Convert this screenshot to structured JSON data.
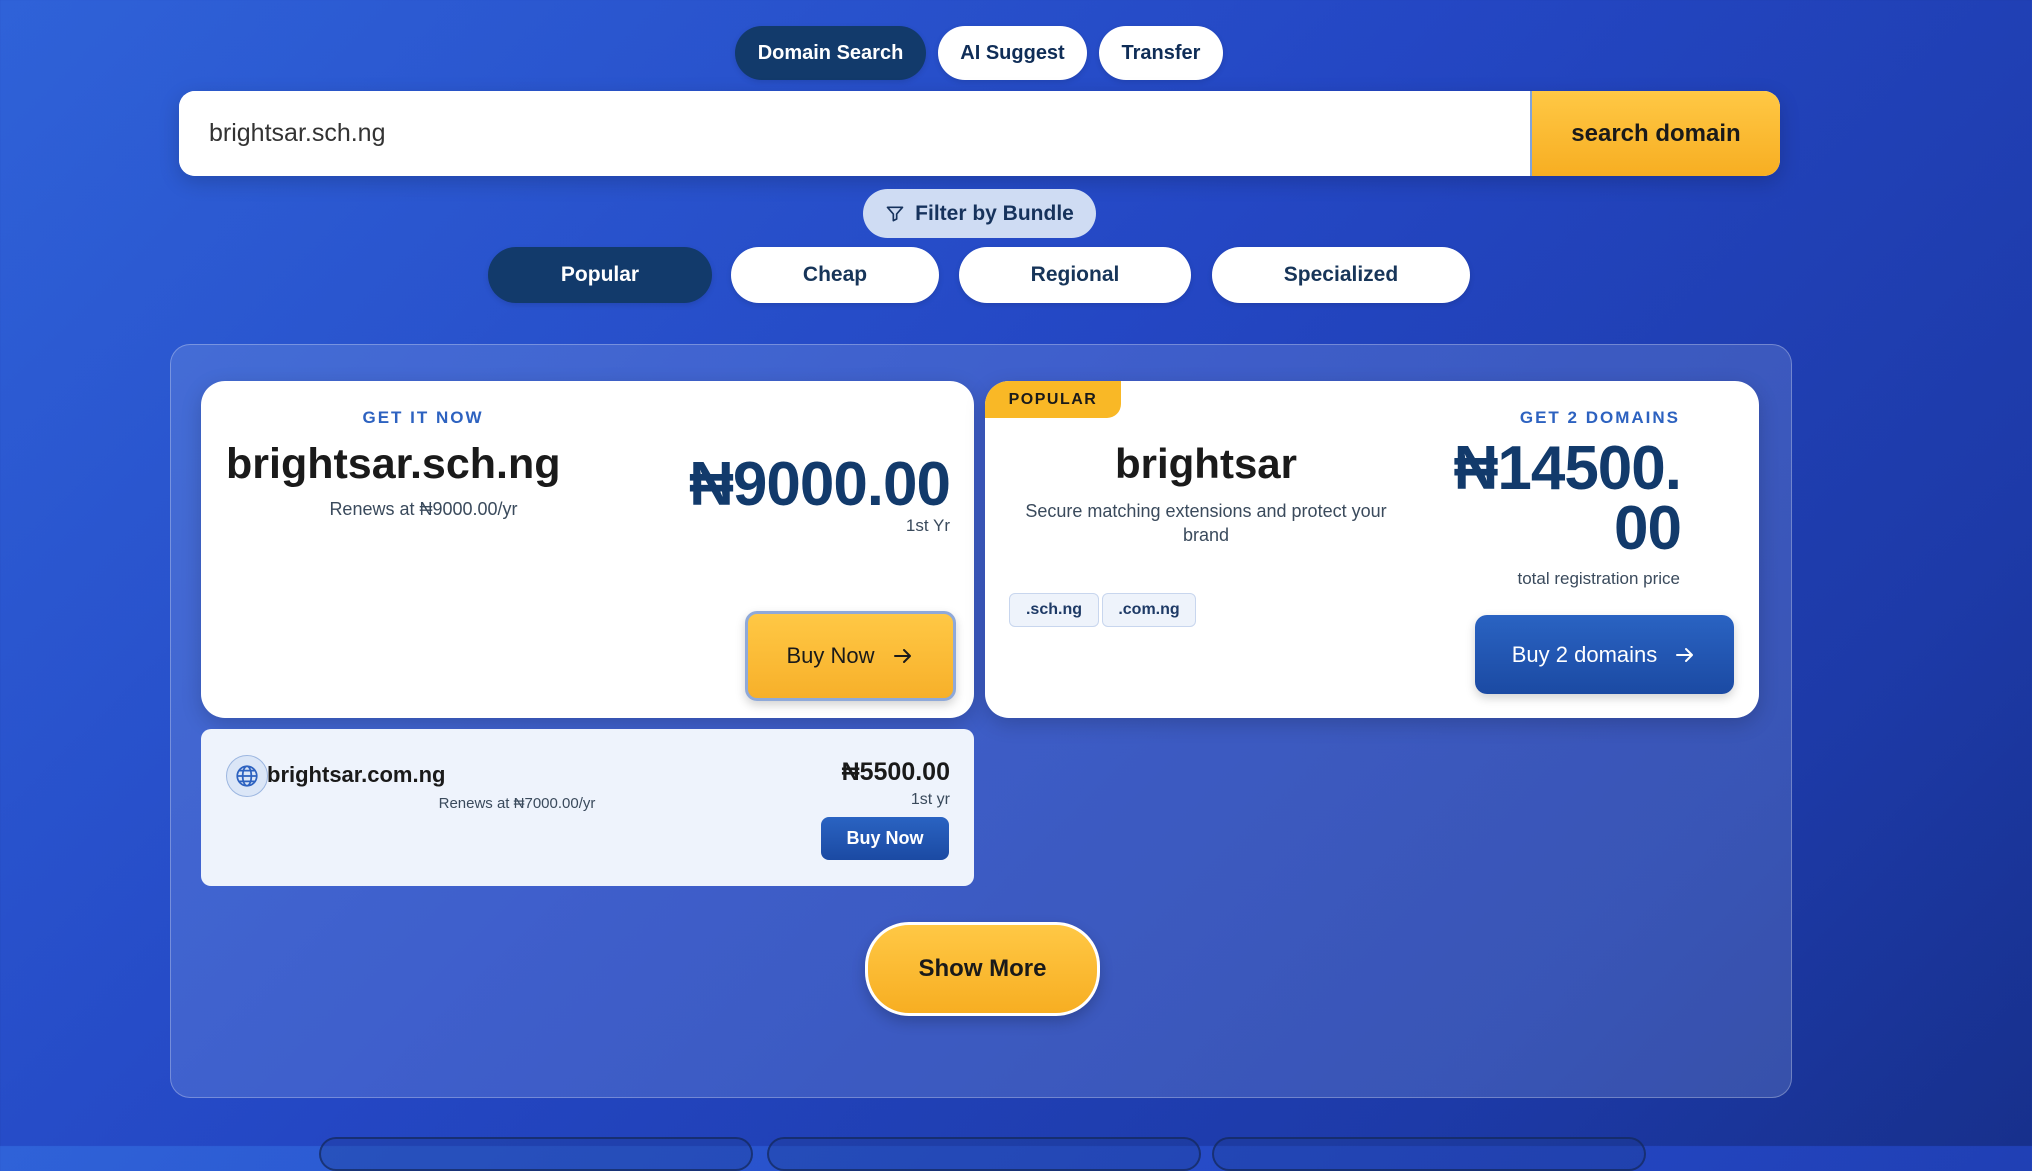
{
  "mode_tabs": [
    {
      "label": "Domain Search",
      "active": true
    },
    {
      "label": "AI Suggest",
      "active": false
    },
    {
      "label": "Transfer",
      "active": false
    }
  ],
  "search": {
    "value": "brightsar.sch.ng",
    "button_label": "search domain"
  },
  "filter": {
    "label": "Filter by Bundle",
    "icon": "filter-icon"
  },
  "categories": [
    {
      "label": "Popular",
      "active": true
    },
    {
      "label": "Cheap",
      "active": false
    },
    {
      "label": "Regional",
      "active": false
    },
    {
      "label": "Specialized",
      "active": false
    }
  ],
  "primary_card": {
    "eyebrow": "GET IT NOW",
    "domain": "brightsar.sch.ng",
    "renew_text": "Renews at ₦9000.00/yr",
    "price": "₦9000.00",
    "price_period": "1st Yr",
    "buy_label": "Buy Now"
  },
  "bundle_card": {
    "badge": "POPULAR",
    "eyebrow": "GET 2 DOMAINS",
    "name": "brightsar",
    "description": "Secure matching extensions and protect your brand",
    "price_line1": "₦14500.",
    "price_line2": "00",
    "price_caption": "total registration price",
    "extensions": [
      ".sch.ng",
      ".com.ng"
    ],
    "buy_label": "Buy 2 domains"
  },
  "alt_result": {
    "icon": "globe-icon",
    "domain": "brightsar.com.ng",
    "renew_text": "Renews at ₦7000.00/yr",
    "price": "₦5500.00",
    "price_period": "1st yr",
    "buy_label": "Buy Now"
  },
  "show_more_label": "Show More",
  "colors": {
    "navy": "#123a6b",
    "accent_gold": "#f7ae22",
    "accent_blue": "#1b4aa3",
    "background_blue": "#2447c4"
  }
}
